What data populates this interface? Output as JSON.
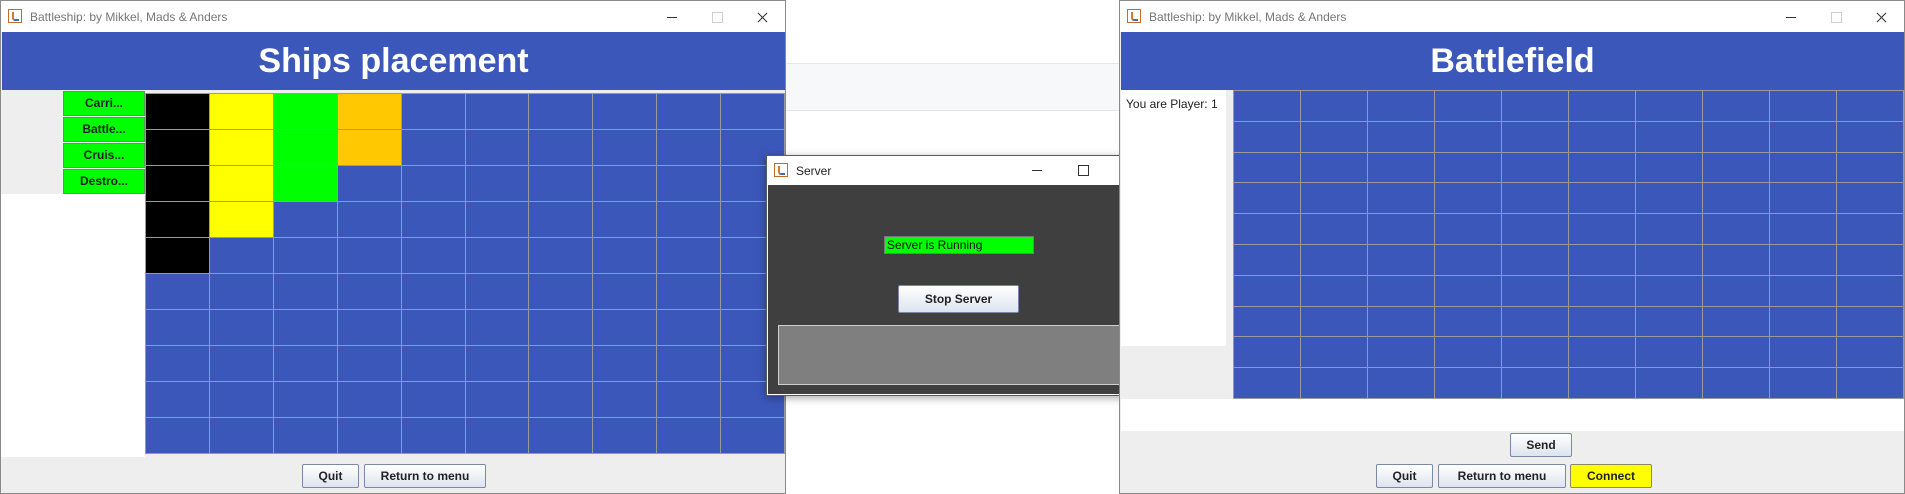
{
  "colors": {
    "board_blue": "#3b57b9",
    "ship_carrier": "#000000",
    "ship_battleship": "#ffff00",
    "ship_cruiser": "#00ff00",
    "ship_destroyer": "#ffc800",
    "status_green": "#00ff00",
    "connect_yellow": "#ffff00"
  },
  "left_window": {
    "title": "Battleship: by Mikkel, Mads & Anders",
    "icon": "java-icon",
    "banner": "Ships placement",
    "ships": [
      {
        "label": "Carri..."
      },
      {
        "label": "Battle..."
      },
      {
        "label": "Cruis..."
      },
      {
        "label": "Destro..."
      }
    ],
    "board": {
      "rows": 10,
      "cols": 10,
      "placed": [
        {
          "ship": "carrier",
          "col": 0,
          "row": 0,
          "length": 5
        },
        {
          "ship": "battleship",
          "col": 1,
          "row": 0,
          "length": 4
        },
        {
          "ship": "cruiser",
          "col": 2,
          "row": 0,
          "length": 3
        },
        {
          "ship": "destroyer",
          "col": 3,
          "row": 0,
          "length": 2
        }
      ]
    },
    "buttons": {
      "quit": "Quit",
      "return": "Return to menu"
    }
  },
  "server_window": {
    "title": "Server",
    "icon": "java-icon",
    "status": "Server is Running",
    "stop_button": "Stop Server",
    "log": ""
  },
  "right_window": {
    "title": "Battleship: by Mikkel, Mads & Anders",
    "icon": "java-icon",
    "banner": "Battlefield",
    "player_text": "You are Player: 1",
    "board": {
      "rows": 10,
      "cols": 10
    },
    "buttons": {
      "send": "Send",
      "quit": "Quit",
      "return": "Return to menu",
      "connect": "Connect"
    }
  }
}
